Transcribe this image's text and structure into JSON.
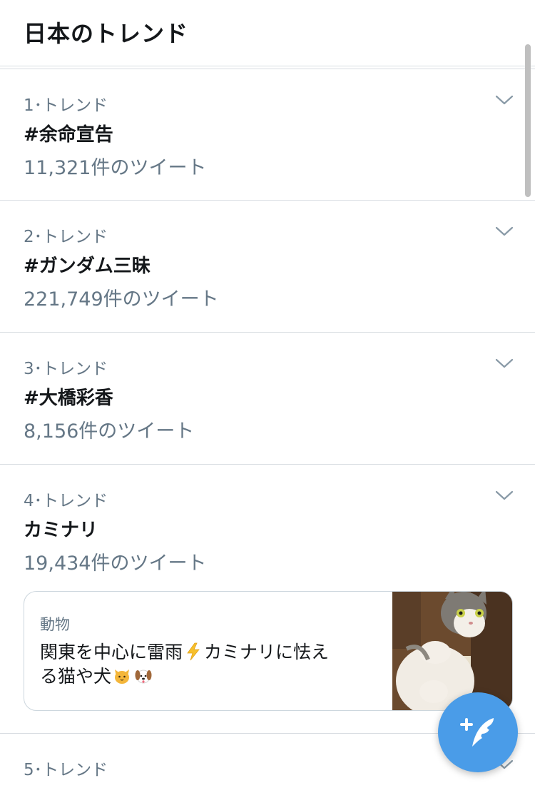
{
  "header": {
    "title": "日本のトレンド"
  },
  "trends": [
    {
      "meta": "1･トレンド",
      "name": "#余命宣告",
      "count": "11,321件のツイート"
    },
    {
      "meta": "2･トレンド",
      "name": "#ガンダム三昧",
      "count": "221,749件のツイート"
    },
    {
      "meta": "3･トレンド",
      "name": "#大橋彩香",
      "count": "8,156件のツイート"
    },
    {
      "meta": "4･トレンド",
      "name": "カミナリ",
      "count": "19,434件のツイート",
      "card": {
        "category": "動物",
        "line1": "関東を中心に雷雨",
        "line1b": "カミナリに怯え",
        "line2": "る猫や犬",
        "emoji_icons": [
          "lightning-emoji-icon",
          "cat-face-emoji-icon",
          "dog-face-emoji-icon"
        ]
      }
    },
    {
      "meta": "5･トレンド"
    }
  ],
  "colors": {
    "accent": "#4a9ce8",
    "muted": "#657786",
    "border": "#d8dde2",
    "text": "#14171a"
  }
}
